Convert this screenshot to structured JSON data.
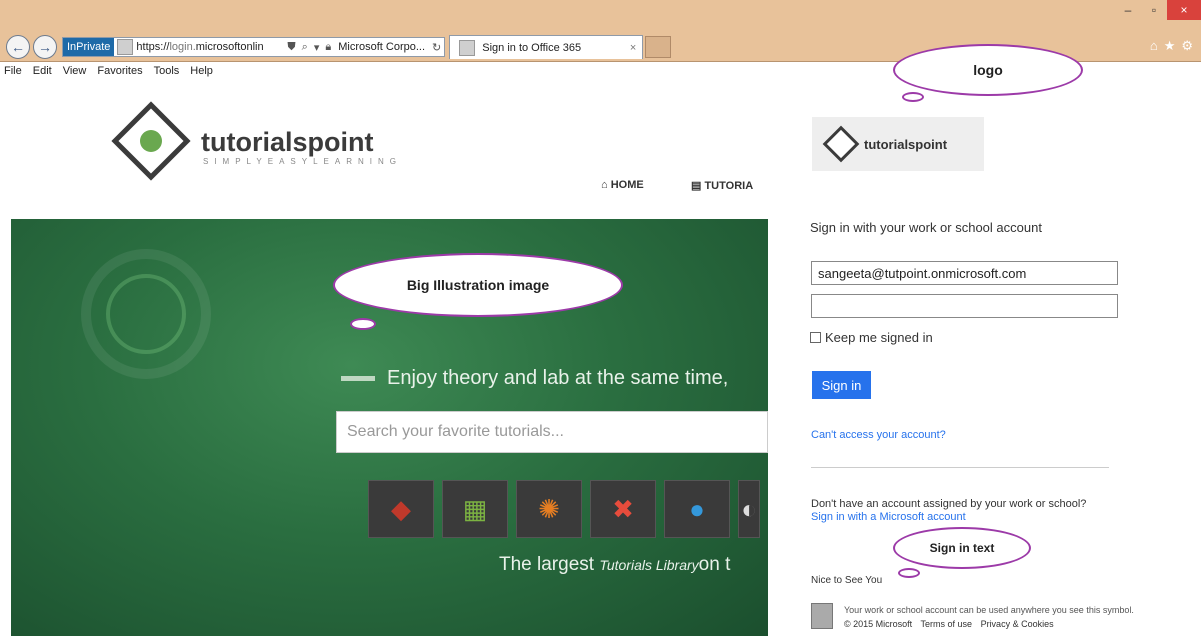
{
  "browser": {
    "inprivate_label": "InPrivate",
    "url_prefix": "https://",
    "url_dim": "login.",
    "url_main": "microsoftonlin",
    "certificate": "Microsoft Corpo...",
    "tab_title": "Sign in to Office 365",
    "tab_close": "×",
    "window_minimize": "–",
    "window_maximize": "▫",
    "window_close": "×",
    "right_icons": [
      "home-icon",
      "star-icon",
      "gear-icon"
    ]
  },
  "menu": [
    "File",
    "Edit",
    "View",
    "Favorites",
    "Tools",
    "Help"
  ],
  "site": {
    "logo_text": "tutorialspoint",
    "logo_sub": "SIMPLYEASYLEARNING",
    "nav_home": "HOME",
    "nav_tutorials": "TUTORIA",
    "hero_enjoy": "Enjoy theory and lab at the same time,",
    "search_placeholder": "Search your favorite tutorials...",
    "tagline_prefix": "The largest ",
    "tagline_italic": "Tutorials Library",
    "tagline_suffix": "on t"
  },
  "signin": {
    "logo_text": "tutorialspoint",
    "heading": "Sign in with your work or school account",
    "email_value": "sangeeta@tutpoint.onmicrosoft.com",
    "keep_signed_in": "Keep me signed in",
    "signin_button": "Sign in",
    "cant_access": "Can't access your account?",
    "dont_have": "Don't have an account assigned by your work or school?",
    "ms_account_link": "Sign in with a Microsoft account",
    "nice_to_see": "Nice to See You",
    "footer_msg": "Your work or school account can be used anywhere you see this symbol.",
    "copyright": "© 2015 Microsoft",
    "terms": "Terms of use",
    "privacy": "Privacy & Cookies"
  },
  "annotations": {
    "logo": "logo",
    "illustration": "Big Illustration image",
    "signin_text": "Sign in text"
  }
}
